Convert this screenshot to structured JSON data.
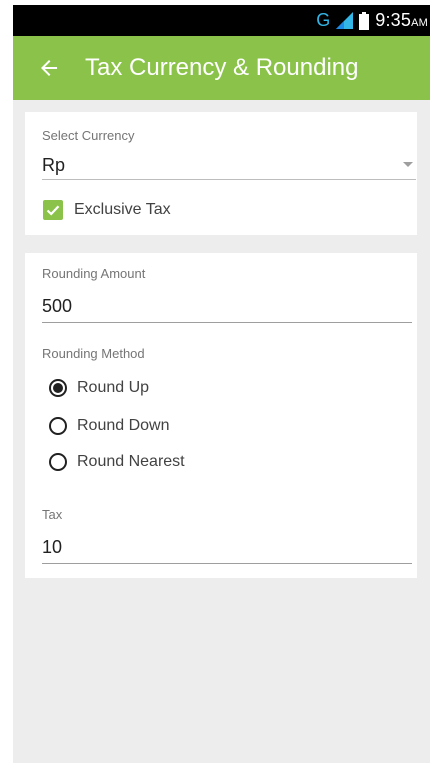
{
  "status_bar": {
    "network_type": "G",
    "time": "9:35",
    "ampm": "AM",
    "icons": [
      "signal-icon",
      "battery-icon"
    ]
  },
  "app_bar": {
    "title": "Tax Currency & Rounding",
    "back_icon": "arrow-left-icon",
    "color": "#8bc34a"
  },
  "currency_section": {
    "label": "Select Currency",
    "selected_value": "Rp",
    "exclusive_tax": {
      "label": "Exclusive Tax",
      "checked": true
    }
  },
  "rounding_section": {
    "amount_label": "Rounding Amount",
    "amount_value": "500",
    "method_label": "Rounding Method",
    "methods": [
      {
        "label": "Round Up",
        "selected": true
      },
      {
        "label": "Round Down",
        "selected": false
      },
      {
        "label": "Round Nearest",
        "selected": false
      }
    ],
    "tax_label": "Tax",
    "tax_value": "10"
  },
  "colors": {
    "accent": "#8bc34a",
    "background": "#ededed",
    "status_network": "#33b5e5"
  }
}
